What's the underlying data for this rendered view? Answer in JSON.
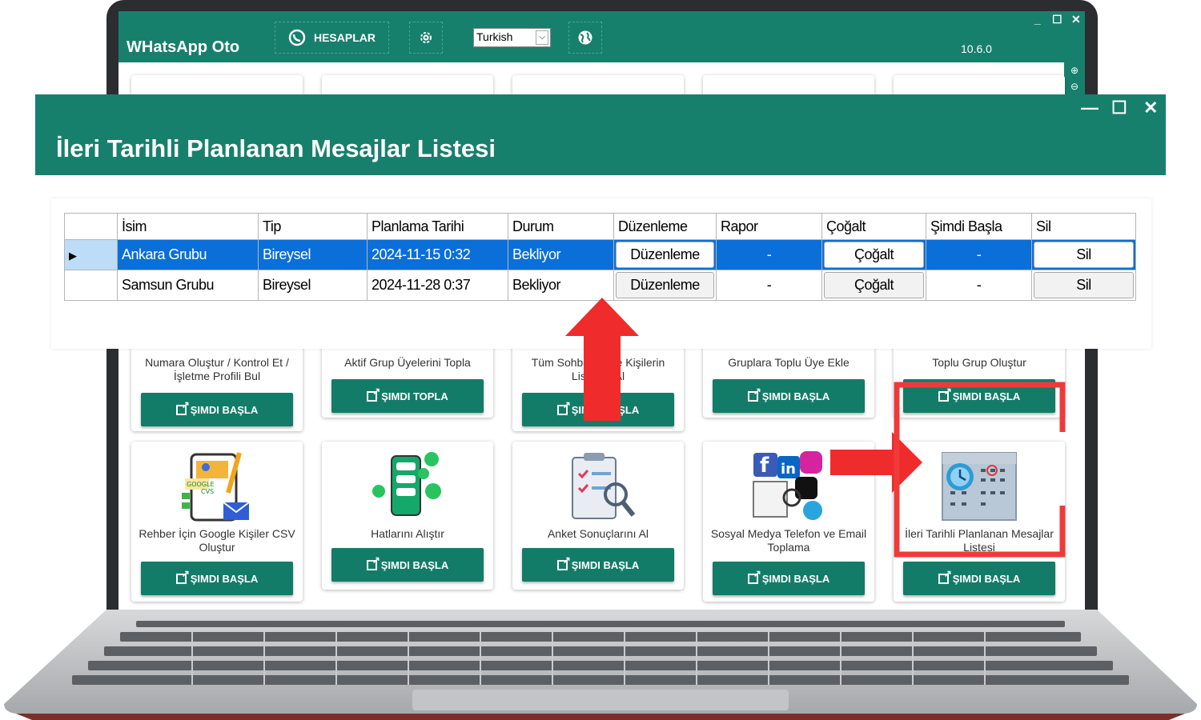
{
  "app": {
    "title": "WHatsApp Oto",
    "accounts_label": "HESAPLAR",
    "language": "Turkish",
    "version": "10.6.0",
    "window_controls": [
      "_",
      "☐",
      "✕"
    ]
  },
  "cards": [
    {
      "label": "Numara Oluştur / Kontrol Et / İşletme Profili Bul",
      "button": "ŞIMDI BAŞLA"
    },
    {
      "label": "Aktif Grup Üyelerini Topla",
      "button": "ŞIMDI TOPLA"
    },
    {
      "label": "Tüm Sohbetleri ve Kişilerin Listesini Al",
      "button": "ŞIMDI BAŞLA"
    },
    {
      "label": "Gruplara Toplu Üye Ekle",
      "button": "ŞIMDI BAŞLA"
    },
    {
      "label": "Toplu Grup Oluştur",
      "button": "ŞIMDI BAŞLA"
    },
    {
      "label": "Rehber İçin Google Kişiler CSV Oluştur",
      "button": "ŞIMDI BAŞLA"
    },
    {
      "label": "Hatlarını Alıştır",
      "button": "ŞIMDI BAŞLA"
    },
    {
      "label": "Anket Sonuçlarını Al",
      "button": "ŞIMDI BAŞLA"
    },
    {
      "label": "Sosyal Medya Telefon ve Email Toplama",
      "button": "ŞIMDI BAŞLA"
    },
    {
      "label": "İleri Tarihli Planlanan Mesajlar Listesi",
      "button": "ŞIMDI BAŞLA"
    }
  ],
  "dialog": {
    "title": "İleri Tarihli Planlanan Mesajlar Listesi",
    "controls": [
      "—",
      "☐",
      "✕"
    ],
    "columns": [
      "İsim",
      "Tip",
      "Planlama Tarihi",
      "Durum",
      "Düzenleme",
      "Rapor",
      "Çoğalt",
      "Şimdi Başla",
      "Sil"
    ],
    "rows": [
      {
        "name": "Ankara Grubu",
        "type": "Bireysel",
        "date": "2024-11-15 0:32",
        "status": "Bekliyor",
        "edit": "Düzenleme",
        "report": "-",
        "copy": "Çoğalt",
        "start": "-",
        "delete": "Sil",
        "selected": true
      },
      {
        "name": "Samsun Grubu",
        "type": "Bireysel",
        "date": "2024-11-28 0:37",
        "status": "Bekliyor",
        "edit": "Düzenleme",
        "report": "-",
        "copy": "Çoğalt",
        "start": "-",
        "delete": "Sil",
        "selected": false
      }
    ]
  },
  "colors": {
    "header_green": "#17806d",
    "button_green": "#137c68",
    "selection_blue": "#0a6fd8",
    "annotation_red": "#ef3a3a"
  },
  "icons": [
    "whatsapp-icon",
    "gear-icon",
    "globe-icon",
    "zoom-in-icon",
    "zoom-out-icon",
    "external-link-icon",
    "row-pointer-icon",
    "calendar-icon"
  ]
}
